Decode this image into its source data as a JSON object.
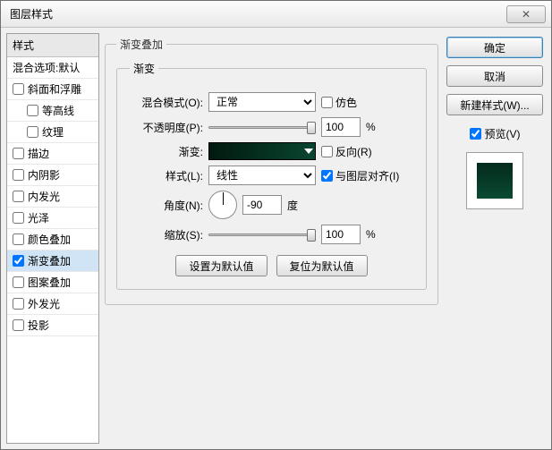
{
  "window": {
    "title": "图层样式",
    "close": "✕"
  },
  "left": {
    "header": "样式",
    "blend_default": "混合选项:默认",
    "items": [
      {
        "label": "斜面和浮雕",
        "checked": false,
        "sub": false
      },
      {
        "label": "等高线",
        "checked": false,
        "sub": true
      },
      {
        "label": "纹理",
        "checked": false,
        "sub": true
      },
      {
        "label": "描边",
        "checked": false,
        "sub": false
      },
      {
        "label": "内阴影",
        "checked": false,
        "sub": false
      },
      {
        "label": "内发光",
        "checked": false,
        "sub": false
      },
      {
        "label": "光泽",
        "checked": false,
        "sub": false
      },
      {
        "label": "颜色叠加",
        "checked": false,
        "sub": false
      },
      {
        "label": "渐变叠加",
        "checked": true,
        "sub": false,
        "selected": true
      },
      {
        "label": "图案叠加",
        "checked": false,
        "sub": false
      },
      {
        "label": "外发光",
        "checked": false,
        "sub": false
      },
      {
        "label": "投影",
        "checked": false,
        "sub": false
      }
    ]
  },
  "group": {
    "title": "渐变叠加",
    "inner_title": "渐变",
    "blend_mode_label": "混合模式(O):",
    "blend_mode_value": "正常",
    "dither_label": "仿色",
    "opacity_label": "不透明度(P):",
    "opacity_value": "100",
    "percent": "%",
    "gradient_label": "渐变:",
    "reverse_label": "反向(R)",
    "style_label": "样式(L):",
    "style_value": "线性",
    "align_label": "与图层对齐(I)",
    "angle_label": "角度(N):",
    "angle_value": "-90",
    "angle_unit": "度",
    "scale_label": "缩放(S):",
    "scale_value": "100",
    "reset_default": "设置为默认值",
    "restore_default": "复位为默认值"
  },
  "right": {
    "ok": "确定",
    "cancel": "取消",
    "new_style": "新建样式(W)...",
    "preview_label": "预览(V)"
  }
}
